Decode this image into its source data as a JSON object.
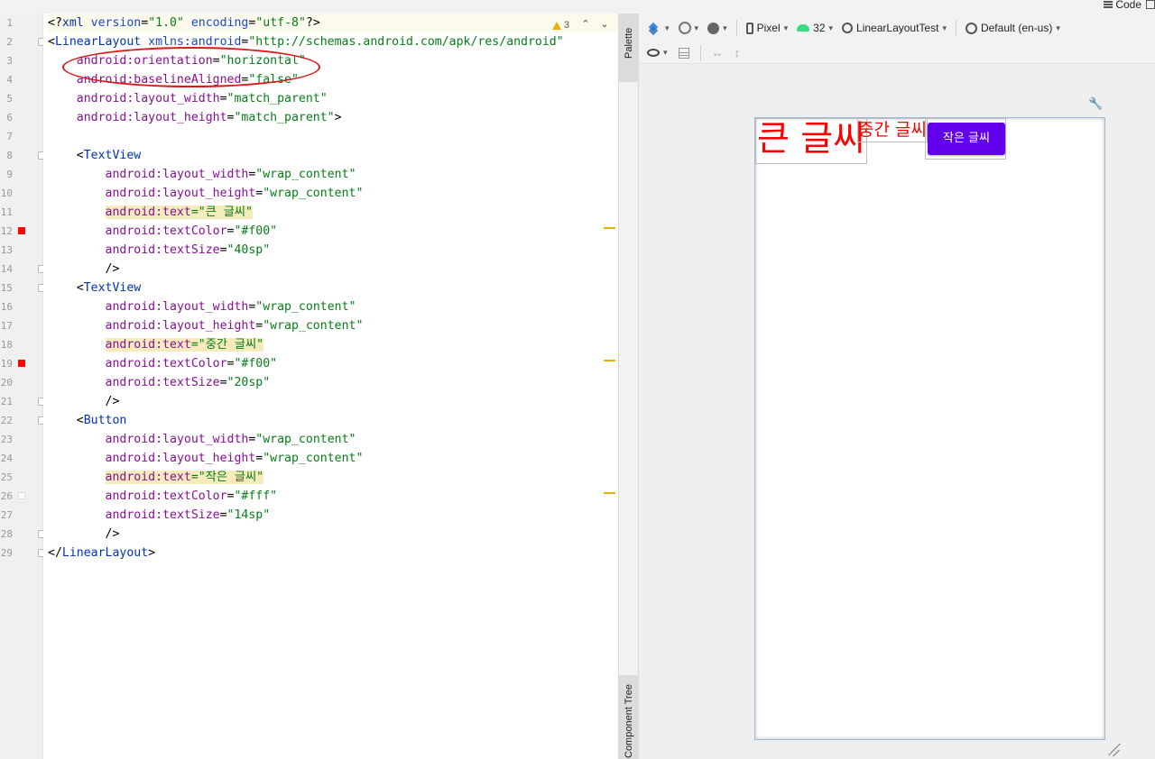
{
  "top_bar": {
    "code_label": "Code"
  },
  "editor": {
    "lines": [
      {
        "n": "1",
        "tokens": [
          [
            "<?",
            "punct"
          ],
          [
            "xml ",
            "tag"
          ],
          [
            "version",
            "attr"
          ],
          [
            "=",
            "punct"
          ],
          [
            "\"1.0\"",
            "val"
          ],
          [
            " ",
            "punct"
          ],
          [
            "encoding",
            "attr"
          ],
          [
            "=",
            "punct"
          ],
          [
            "\"utf-8\"",
            "val"
          ],
          [
            "?>",
            "punct"
          ]
        ]
      },
      {
        "n": "2",
        "tokens": [
          [
            "<",
            "punct"
          ],
          [
            "LinearLayout ",
            "tag"
          ],
          [
            "xmlns:android",
            "attr"
          ],
          [
            "=",
            "punct"
          ],
          [
            "\"http://schemas.android.com/apk/res/android\"",
            "val"
          ]
        ]
      },
      {
        "n": "3",
        "tokens": [
          [
            "    ",
            "punct"
          ],
          [
            "android:",
            "ns"
          ],
          [
            "orientation",
            "ns"
          ],
          [
            "=",
            "punct"
          ],
          [
            "\"horizontal\"",
            "val"
          ]
        ]
      },
      {
        "n": "4",
        "tokens": [
          [
            "    ",
            "punct"
          ],
          [
            "android:",
            "ns"
          ],
          [
            "baselineAligned",
            "ns"
          ],
          [
            "=",
            "punct"
          ],
          [
            "\"false\"",
            "val"
          ]
        ]
      },
      {
        "n": "5",
        "tokens": [
          [
            "    ",
            "punct"
          ],
          [
            "android:",
            "ns"
          ],
          [
            "layout_width",
            "ns"
          ],
          [
            "=",
            "punct"
          ],
          [
            "\"match_parent\"",
            "val"
          ]
        ]
      },
      {
        "n": "6",
        "tokens": [
          [
            "    ",
            "punct"
          ],
          [
            "android:",
            "ns"
          ],
          [
            "layout_height",
            "ns"
          ],
          [
            "=",
            "punct"
          ],
          [
            "\"match_parent\"",
            "val"
          ],
          [
            ">",
            "punct"
          ]
        ]
      },
      {
        "n": "7",
        "tokens": []
      },
      {
        "n": "8",
        "tokens": [
          [
            "    <",
            "punct"
          ],
          [
            "TextView",
            "tag"
          ]
        ]
      },
      {
        "n": "9",
        "tokens": [
          [
            "        ",
            "punct"
          ],
          [
            "android:",
            "ns"
          ],
          [
            "layout_width",
            "ns"
          ],
          [
            "=",
            "punct"
          ],
          [
            "\"wrap_content\"",
            "val"
          ]
        ]
      },
      {
        "n": "10",
        "tokens": [
          [
            "        ",
            "punct"
          ],
          [
            "android:",
            "ns"
          ],
          [
            "layout_height",
            "ns"
          ],
          [
            "=",
            "punct"
          ],
          [
            "\"wrap_content\"",
            "val"
          ]
        ]
      },
      {
        "n": "11",
        "tokens": [
          [
            "        ",
            "punct"
          ],
          [
            "android:text",
            "attrhl"
          ],
          [
            "=\"큰 글씨\"",
            "valhl"
          ]
        ]
      },
      {
        "n": "12",
        "tokens": [
          [
            "        ",
            "punct"
          ],
          [
            "android:",
            "ns"
          ],
          [
            "textColor",
            "ns"
          ],
          [
            "=",
            "punct"
          ],
          [
            "\"#f00\"",
            "val"
          ]
        ]
      },
      {
        "n": "13",
        "tokens": [
          [
            "        ",
            "punct"
          ],
          [
            "android:",
            "ns"
          ],
          [
            "textSize",
            "ns"
          ],
          [
            "=",
            "punct"
          ],
          [
            "\"40sp\"",
            "val"
          ]
        ]
      },
      {
        "n": "14",
        "tokens": [
          [
            "        />",
            "punct"
          ]
        ]
      },
      {
        "n": "15",
        "tokens": [
          [
            "    <",
            "punct"
          ],
          [
            "TextView",
            "tag"
          ]
        ]
      },
      {
        "n": "16",
        "tokens": [
          [
            "        ",
            "punct"
          ],
          [
            "android:",
            "ns"
          ],
          [
            "layout_width",
            "ns"
          ],
          [
            "=",
            "punct"
          ],
          [
            "\"wrap_content\"",
            "val"
          ]
        ]
      },
      {
        "n": "17",
        "tokens": [
          [
            "        ",
            "punct"
          ],
          [
            "android:",
            "ns"
          ],
          [
            "layout_height",
            "ns"
          ],
          [
            "=",
            "punct"
          ],
          [
            "\"wrap_content\"",
            "val"
          ]
        ]
      },
      {
        "n": "18",
        "tokens": [
          [
            "        ",
            "punct"
          ],
          [
            "android:text",
            "attrhl"
          ],
          [
            "=\"중간 글씨\"",
            "valhl"
          ]
        ]
      },
      {
        "n": "19",
        "tokens": [
          [
            "        ",
            "punct"
          ],
          [
            "android:",
            "ns"
          ],
          [
            "textColor",
            "ns"
          ],
          [
            "=",
            "punct"
          ],
          [
            "\"#f00\"",
            "val"
          ]
        ]
      },
      {
        "n": "20",
        "tokens": [
          [
            "        ",
            "punct"
          ],
          [
            "android:",
            "ns"
          ],
          [
            "textSize",
            "ns"
          ],
          [
            "=",
            "punct"
          ],
          [
            "\"20sp\"",
            "val"
          ]
        ]
      },
      {
        "n": "21",
        "tokens": [
          [
            "        />",
            "punct"
          ]
        ]
      },
      {
        "n": "22",
        "tokens": [
          [
            "    <",
            "punct"
          ],
          [
            "Button",
            "tag"
          ]
        ]
      },
      {
        "n": "23",
        "tokens": [
          [
            "        ",
            "punct"
          ],
          [
            "android:",
            "ns"
          ],
          [
            "layout_width",
            "ns"
          ],
          [
            "=",
            "punct"
          ],
          [
            "\"wrap_content\"",
            "val"
          ]
        ]
      },
      {
        "n": "24",
        "tokens": [
          [
            "        ",
            "punct"
          ],
          [
            "android:",
            "ns"
          ],
          [
            "layout_height",
            "ns"
          ],
          [
            "=",
            "punct"
          ],
          [
            "\"wrap_content\"",
            "val"
          ]
        ]
      },
      {
        "n": "25",
        "tokens": [
          [
            "        ",
            "punct"
          ],
          [
            "android:text",
            "attrhl"
          ],
          [
            "=\"작은 글씨\"",
            "valhl"
          ]
        ]
      },
      {
        "n": "26",
        "tokens": [
          [
            "        ",
            "punct"
          ],
          [
            "android:",
            "ns"
          ],
          [
            "textColor",
            "ns"
          ],
          [
            "=",
            "punct"
          ],
          [
            "\"#fff\"",
            "val"
          ]
        ]
      },
      {
        "n": "27",
        "tokens": [
          [
            "        ",
            "punct"
          ],
          [
            "android:",
            "ns"
          ],
          [
            "textSize",
            "ns"
          ],
          [
            "=",
            "punct"
          ],
          [
            "\"14sp\"",
            "val"
          ]
        ]
      },
      {
        "n": "28",
        "tokens": [
          [
            "        />",
            "punct"
          ]
        ]
      },
      {
        "n": "29",
        "tokens": [
          [
            "</",
            "punct"
          ],
          [
            "LinearLayout",
            "tag"
          ],
          [
            ">",
            "punct"
          ]
        ]
      }
    ],
    "gutter_color_markers": [
      {
        "line": "12",
        "color": "#ff0000"
      },
      {
        "line": "19",
        "color": "#ff0000"
      },
      {
        "line": "26",
        "color": "#ffffff"
      }
    ],
    "fold_lines": [
      "2",
      "8",
      "14",
      "15",
      "21",
      "22",
      "28",
      "29"
    ],
    "warnings": {
      "count": "3"
    },
    "annotation_color": "#d91a1a"
  },
  "side_panel": {
    "palette_label": "Palette",
    "component_tree_label": "Component Tree"
  },
  "design_toolbar": {
    "device": "Pixel",
    "api_level": "32",
    "theme": "LinearLayoutTest",
    "locale": "Default (en-us)"
  },
  "preview": {
    "big_text": "큰 글씨",
    "mid_text": "중간 글씨",
    "button_text": "작은 글씨",
    "text_color": "#ff0000",
    "button_color": "#6200ee"
  }
}
